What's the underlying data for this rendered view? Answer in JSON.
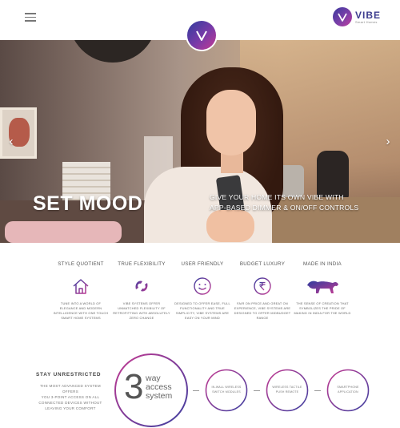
{
  "header": {
    "logo": {
      "name": "VIBE",
      "sub": "Smart Homes",
      "mark": "V"
    },
    "badge": "V",
    "menu_icon": "hamburger-icon"
  },
  "hero": {
    "title": "SET MOOD",
    "subtitle_line1": "GIVE YOUR HOME ITS OWN VIBE WITH",
    "subtitle_line2": "APP-BASED DIMMER & ON/OFF CONTROLS",
    "prev": "‹",
    "next": "›"
  },
  "features": [
    {
      "title": "STYLE QUOTIENT",
      "icon": "house-icon",
      "desc": [
        "TUNE INTO A WORLD OF",
        "ELEGANCE AND MODERN",
        "INTELLIGENCE WITH ONE TOUCH",
        "SMART HOME SYSTEMS"
      ]
    },
    {
      "title": "TRUE FLEXIBILITY",
      "icon": "flexibility-icon",
      "desc": [
        "VIBE SYSTEMS OFFER",
        "UNMATCHED FLEXIBILITY OF",
        "RETROFITTING WITH ABSOLUTELY",
        "ZERO CHANGE"
      ]
    },
    {
      "title": "USER FRIENDLY",
      "icon": "smiley-icon",
      "desc": [
        "DESIGNED TO OFFER EASE, FULL",
        "FUNCTIONALITY AND TRUE",
        "SIMPLICITY, VIBE SYSTEMS ARE",
        "EASY ON YOUR MIND"
      ]
    },
    {
      "title": "BUDGET LUXURY",
      "icon": "rupee-icon",
      "desc": [
        "FAIR ON PRICE AND GREAT ON",
        "EXPERIENCE, VIBE SYSTEMS ARE",
        "DESIGNED TO OFFER MIDBUDGET",
        "RANGE"
      ]
    },
    {
      "title": "MADE IN INDIA",
      "icon": "lion-icon",
      "desc": [
        "THE SENSE OF CREATION THAT",
        "SYMBOLIZES THE PRIDE OF",
        "MAKING IN INDIA FOR THE WORLD"
      ]
    }
  ],
  "access": {
    "title": "STAY UNRESTRICTED",
    "desc": [
      "THE MOST ADVANCED SYSTEM OFFERS",
      "YOU 3-POINT ACCESS ON ALL",
      "CONNECTED DEVICES WITHOUT",
      "LEAVING YOUR COMFORT"
    ],
    "number": "3",
    "way": [
      "way",
      "access",
      "system"
    ],
    "points": [
      [
        "IN-WALL WIRELESS",
        "SWITCH MODULES"
      ],
      [
        "WIRELESS TACTILE",
        "PUSH REMOTE"
      ],
      [
        "SMARTPHONE",
        "APPLICATION"
      ]
    ]
  },
  "colors": {
    "gradient_start": "#2f3d9e",
    "gradient_mid": "#7a3aa8",
    "gradient_end": "#c43a92"
  }
}
